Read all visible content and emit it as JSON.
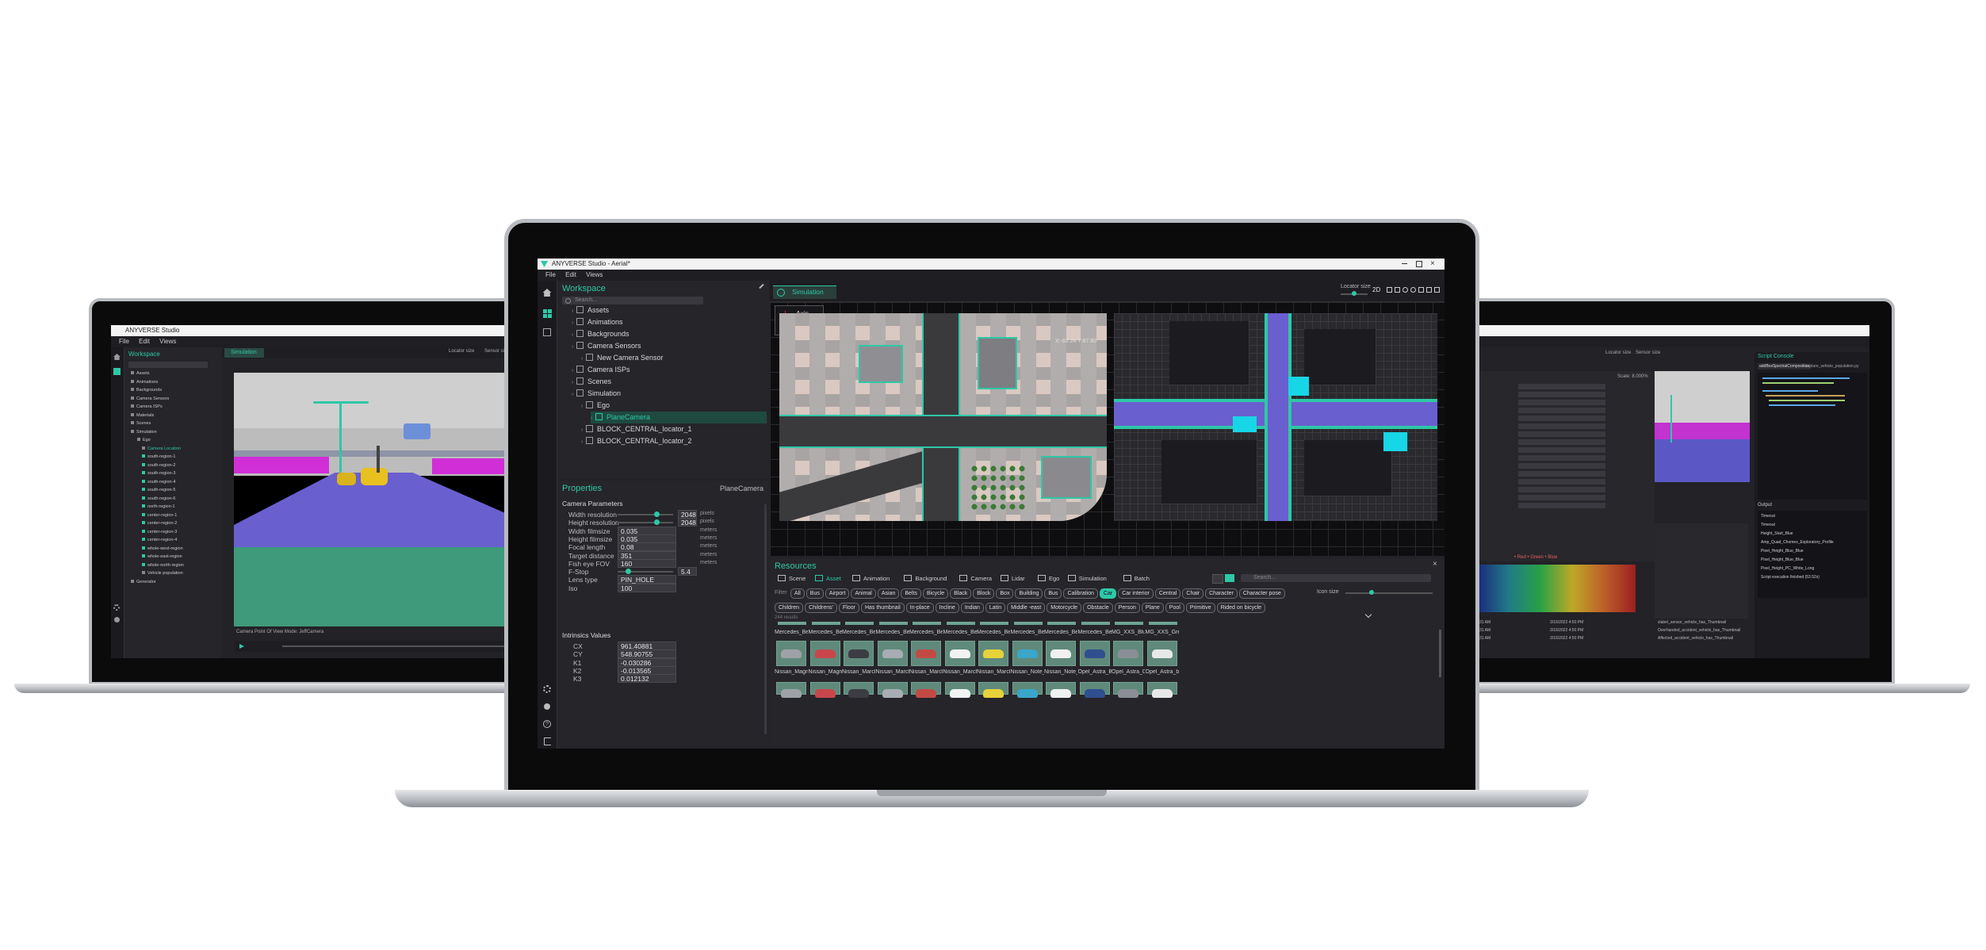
{
  "center": {
    "window_title": "ANYVERSE Studio - Aerial*",
    "menu": [
      "File",
      "Edit",
      "Views"
    ],
    "workspace": {
      "title": "Workspace",
      "search_placeholder": "Search...",
      "tree": [
        {
          "label": "Assets",
          "depth": 0
        },
        {
          "label": "Animations",
          "depth": 0
        },
        {
          "label": "Backgrounds",
          "depth": 0
        },
        {
          "label": "Camera Sensors",
          "depth": 0
        },
        {
          "label": "New Camera Sensor",
          "depth": 1
        },
        {
          "label": "Camera ISPs",
          "depth": 0
        },
        {
          "label": "Scenes",
          "depth": 0
        },
        {
          "label": "Simulation",
          "depth": 0
        },
        {
          "label": "Ego",
          "depth": 1
        },
        {
          "label": "PlaneCamera",
          "depth": 2,
          "selected": true
        },
        {
          "label": "BLOCK_CENTRAL_locator_1",
          "depth": 1
        },
        {
          "label": "BLOCK_CENTRAL_locator_2",
          "depth": 1
        }
      ]
    },
    "properties": {
      "title": "Properties",
      "object": "PlaneCamera",
      "section_camera": "Camera Parameters",
      "rows": [
        {
          "label": "Width resolution",
          "value": "2048",
          "unit": "pixels",
          "slider": 0.72
        },
        {
          "label": "Height resolution",
          "value": "2048",
          "unit": "pixels",
          "slider": 0.72
        },
        {
          "label": "Width filmsize",
          "value": "0.035",
          "unit": "meters"
        },
        {
          "label": "Height filmsize",
          "value": "0.035",
          "unit": "meters"
        },
        {
          "label": "Focal length",
          "value": "0.08",
          "unit": "meters"
        },
        {
          "label": "Target distance",
          "value": "351",
          "unit": "meters"
        },
        {
          "label": "Fish eye FOV",
          "value": "160",
          "unit": "meters"
        },
        {
          "label": "F-Stop",
          "value": "5.4",
          "unit": "",
          "slider": 0.15
        },
        {
          "label": "Lens type",
          "value": "PIN_HOLE",
          "unit": ""
        },
        {
          "label": "Iso",
          "value": "100",
          "unit": ""
        }
      ],
      "section_intrinsics": "Intrinsics Values",
      "intrinsics": [
        {
          "label": "CX",
          "value": "961.40881"
        },
        {
          "label": "CY",
          "value": "548.90755"
        },
        {
          "label": "K1",
          "value": "-0.030286"
        },
        {
          "label": "K2",
          "value": "-0.013565"
        },
        {
          "label": "K3",
          "value": "0.012132"
        }
      ]
    },
    "simulation": {
      "tab": "Simulation",
      "locator_size_label": "Locator size",
      "mode_2d": "2D",
      "axis_label": "Axis",
      "coords": "X:-62.24  Y:87.80"
    },
    "resources": {
      "title": "Resources",
      "tabs": [
        "Scene",
        "Asset",
        "Animation",
        "Background",
        "Camera",
        "Lidar",
        "Ego",
        "Simulation",
        "Batch"
      ],
      "active_tab": "Asset",
      "search_placeholder": "Search...",
      "filter_label": "Filter",
      "filters_row1": [
        "All",
        "Bus",
        "Airport",
        "Animal",
        "Asian",
        "Belts",
        "Bicycle",
        "Black",
        "Block",
        "Box",
        "Building",
        "Bus",
        "Calibration",
        "Car",
        "Car interior",
        "Central",
        "Chair",
        "Character",
        "Character pose"
      ],
      "selected_filter": "Car",
      "filters_row2": [
        "Children",
        "Childrens'",
        "Floor",
        "Has thumbnail",
        "In-place",
        "Incline",
        "Indian",
        "Latin",
        "Middle -east",
        "Motorcycle",
        "Obstacle",
        "Person",
        "Plane",
        "Pool",
        "Primitive",
        "Rided on bicycle"
      ],
      "icon_size_label": "Icon size",
      "results": "244 results",
      "row_top_labels": [
        "Mercedes_Benz_...",
        "Mercedes_Benz_...",
        "Mercedes_Benz_...",
        "Mercedes_Benz_...",
        "Mercedes_Benz_...",
        "Mercedes_Benz_...",
        "Mercedes_Benz_...",
        "Mercedes_Benz_...",
        "Mercedes_Benz_...",
        "Mercedes_Benz_...",
        "MG_XXS_BlueSky",
        "MG_XXS_GreyPe..."
      ],
      "cars": [
        {
          "label": "Nissan_Magnite_...",
          "color": "#9ea2a6"
        },
        {
          "label": "Nissan_Magnite_...",
          "color": "#c8464b"
        },
        {
          "label": "Nissan_March_Bl...",
          "color": "#3b3d42"
        },
        {
          "label": "Nissan_March_G...",
          "color": "#a7adb2"
        },
        {
          "label": "Nissan_March_R...",
          "color": "#c24a44"
        },
        {
          "label": "Nissan_March_...",
          "color": "#f2f2f2"
        },
        {
          "label": "Nissan_March_Y...",
          "color": "#e6d23a"
        },
        {
          "label": "Nissan_Note_Ep...",
          "color": "#3aa6c9"
        },
        {
          "label": "Nissan_Note_Ep...",
          "color": "#f0f0f0"
        },
        {
          "label": "Opel_Astra_Blue...",
          "color": "#2f4f8f"
        },
        {
          "label": "Opel_Astra_Grey",
          "color": "#8a8f95"
        },
        {
          "label": "Opel_Astra_bron...",
          "color": "#e8e8e8"
        }
      ]
    }
  },
  "left": {
    "window_title": "ANYVERSE Studio",
    "menu": [
      "File",
      "Edit",
      "Views"
    ],
    "panel_title": "Workspace",
    "tab": "Simulation",
    "tree": [
      "Assets",
      "Animations",
      "Backgrounds",
      "Camera Sensors",
      "Camera ISPs",
      "Materials",
      "Scenes",
      "Simulation",
      "Ego",
      "Camera Location",
      "south-region-1",
      "south-region-2",
      "south-region-3",
      "south-region-4",
      "south-region-5",
      "south-region-6",
      "north-region-1",
      "center-region-1",
      "center-region-2",
      "center-region-3",
      "center-region-4",
      "whole-west-region",
      "whole-east-region",
      "whole-north-region",
      "Vehicle population",
      "Generator"
    ],
    "locator_size_label": "Locator size",
    "sensor_size_label": "Sensor size",
    "viewport_caption": "Camera Point Of View Mode: JeffCamera"
  },
  "right": {
    "script_console_title": "Script Console",
    "tab_1": "addBoxSpectralComposition",
    "tab_2": "capture_vehicle_population.py",
    "locator_size_label": "Locator size",
    "sensor_size_label": "Sensor size",
    "scale_label": "Scale: 8.000%",
    "legend": "• Red  • Green  • Blue",
    "output_title": "Output",
    "output_lines": [
      "Timeout",
      "Timeout",
      "Height_Start_Blue",
      "Amp_Quad_Chomes_Exploratory_Profile",
      "Pixel_Height_Blue_Blue",
      "Pixel_Height_Blue_Blue",
      "Pixel_Height_PC_White_Long",
      "Script execution finished (53.52s)"
    ],
    "log_rows": [
      {
        "time": "10:31 AM",
        "date": "3/16/2022 4:50 PM",
        "text": "slabel_sensor_vehicle_has_Thumbnail"
      },
      {
        "time": "10:31 AM",
        "date": "3/16/2022 4:50 PM",
        "text": "Overhanded_accident_vehicle_has_Thumbnail"
      },
      {
        "time": "10:31 AM",
        "date": "3/16/2022 4:50 PM",
        "text": "Affected_accident_vehicle_has_Thumbnail"
      }
    ]
  },
  "colors": {
    "accent": "#2ec8a6",
    "panel": "#232227",
    "rail": "#1b1a1f",
    "lid": "#0b0b0c"
  }
}
